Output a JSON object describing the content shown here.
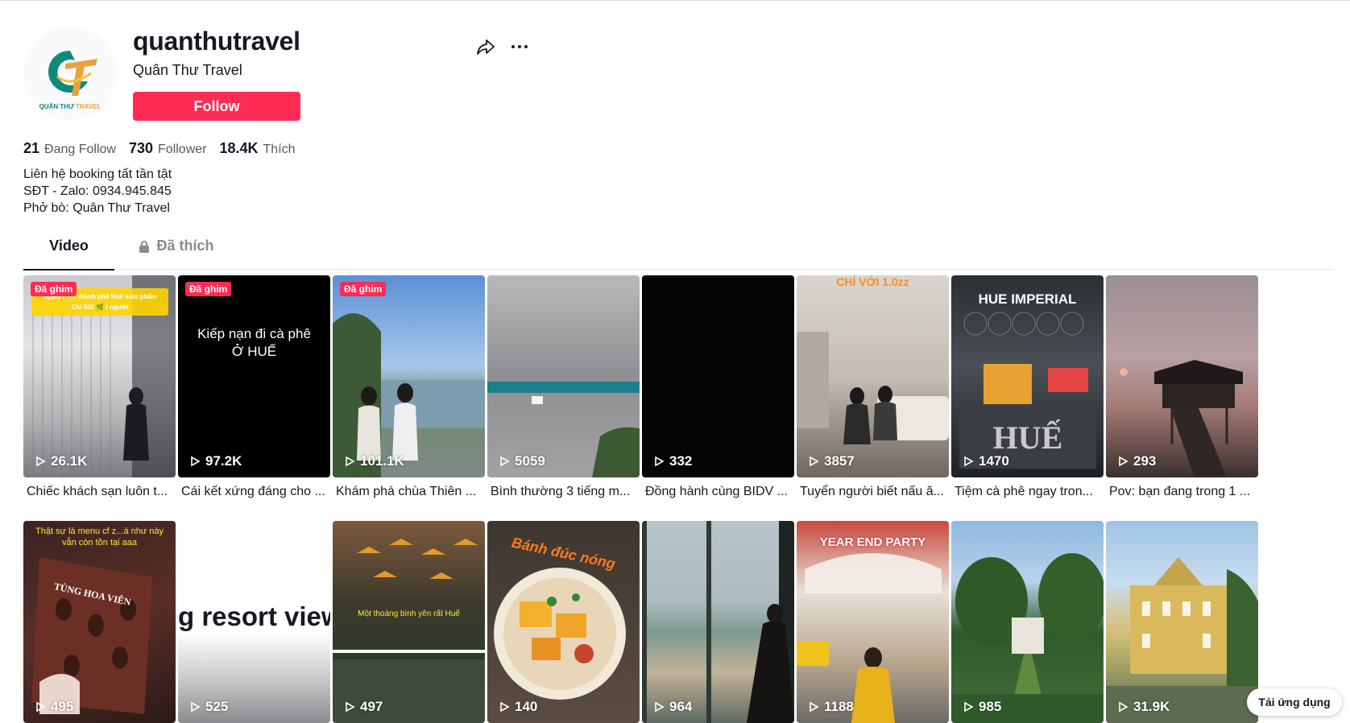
{
  "profile": {
    "username": "quanthutravel",
    "nickname": "Quân Thư Travel",
    "avatar_text": "QUÂN THƯ TRAVEL",
    "follow_label": "Follow",
    "share_icon": "share-icon",
    "more_icon": "more-icon"
  },
  "stats": {
    "following_count": "21",
    "following_label": "Đang Follow",
    "followers_count": "730",
    "followers_label": "Follower",
    "likes_count": "18.4K",
    "likes_label": "Thích"
  },
  "bio": "Liên hệ booking tất tần tật\nSĐT - Zalo: 0934.945.845\nPhở bò: Quân Thư Travel",
  "tabs": {
    "video": "Video",
    "liked": "Đã thích"
  },
  "videos": [
    {
      "views": "26.1K",
      "caption": "Chiếc khách sạn luôn t...",
      "pinned": "Đã ghim",
      "overlay": ""
    },
    {
      "views": "97.2K",
      "caption": "Cái kết xứng đáng cho ...",
      "pinned": "Đã ghim",
      "overlay": "Kiếp nạn đi cà phê\nỞ HUẾ"
    },
    {
      "views": "101.1K",
      "caption": "Khám phá chùa Thiên ...",
      "pinned": "Đã ghim",
      "overlay": ""
    },
    {
      "views": "5059",
      "caption": "Bình thường 3 tiếng m...",
      "pinned": "",
      "overlay": ""
    },
    {
      "views": "332",
      "caption": "Đồng hành cùng BIDV ...",
      "pinned": "",
      "overlay": ""
    },
    {
      "views": "3857",
      "caption": "Tuyển người biết nấu ă...",
      "pinned": "",
      "overlay": "CHỈ VỚI 1.0zz"
    },
    {
      "views": "1470",
      "caption": "Tiệm cà phê ngay tron...",
      "pinned": "",
      "overlay": "HUE IMPERIAL"
    },
    {
      "views": "293",
      "caption": "Pov: bạn đang trong 1 ...",
      "pinned": "",
      "overlay": ""
    },
    {
      "views": "495",
      "caption": "",
      "pinned": "",
      "overlay": "Thật sự là menu cf z...á như này\nvẫn còn tồn tại aaa"
    },
    {
      "views": "525",
      "caption": "",
      "pinned": "",
      "overlay": "g resort view"
    },
    {
      "views": "497",
      "caption": "",
      "pinned": "",
      "overlay": "Một thoáng bình yên rất Huế"
    },
    {
      "views": "140",
      "caption": "",
      "pinned": "",
      "overlay": "Bánh đúc nóng"
    },
    {
      "views": "964",
      "caption": "",
      "pinned": "",
      "overlay": ""
    },
    {
      "views": "1188",
      "caption": "",
      "pinned": "",
      "overlay": "YEAR END PARTY"
    },
    {
      "views": "985",
      "caption": "",
      "pinned": "",
      "overlay": ""
    },
    {
      "views": "31.9K",
      "caption": "",
      "pinned": "",
      "overlay": ""
    }
  ],
  "app_button": "Tải ứng dụng"
}
